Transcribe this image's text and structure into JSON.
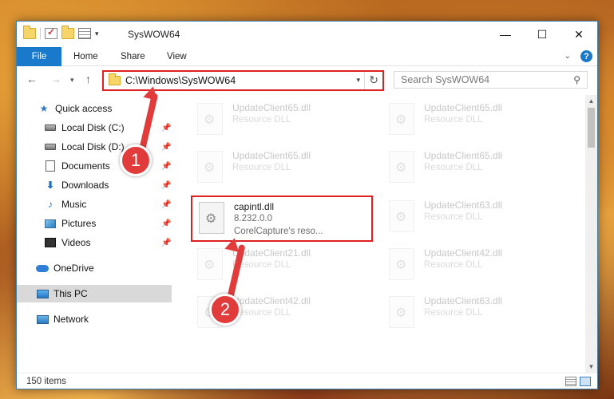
{
  "window": {
    "title": "SysWOW64",
    "controls": {
      "minimize": "—",
      "maximize": "☐",
      "close": "✕"
    }
  },
  "ribbon": {
    "tabs": [
      {
        "label": "File"
      },
      {
        "label": "Home"
      },
      {
        "label": "Share"
      },
      {
        "label": "View"
      }
    ]
  },
  "address": {
    "path": "C:\\Windows\\SysWOW64",
    "search_placeholder": "Search SysWOW64"
  },
  "sidebar": {
    "items": [
      {
        "label": "Quick access",
        "icon": "star-icon"
      },
      {
        "label": "Local Disk (C:)",
        "icon": "drive-icon"
      },
      {
        "label": "Local Disk (D:)",
        "icon": "drive-icon"
      },
      {
        "label": "Documents",
        "icon": "documents-icon"
      },
      {
        "label": "Downloads",
        "icon": "download-icon"
      },
      {
        "label": "Music",
        "icon": "music-icon"
      },
      {
        "label": "Pictures",
        "icon": "pictures-icon"
      },
      {
        "label": "Videos",
        "icon": "videos-icon"
      },
      {
        "label": "OneDrive",
        "icon": "cloud-icon"
      },
      {
        "label": "This PC",
        "icon": "computer-icon"
      },
      {
        "label": "Network",
        "icon": "network-icon"
      }
    ]
  },
  "files": [
    {
      "name": "UpdateClient65.dll",
      "type": "Resource DLL"
    },
    {
      "name": "UpdateClient65.dll",
      "type": "Resource DLL"
    },
    {
      "name": "UpdateClient65.dll",
      "type": "Resource DLL"
    },
    {
      "name": "UpdateClient65.dll",
      "type": "Resource DLL"
    },
    {
      "name": "capintl.dll",
      "version": "8.232.0.0",
      "description": "CorelCapture's reso..."
    },
    {
      "name": "UpdateClient63.dll",
      "type": "Resource DLL"
    },
    {
      "name": "UpdateClient21.dll",
      "type": "Resource DLL"
    },
    {
      "name": "UpdateClient42.dll",
      "type": "Resource DLL"
    },
    {
      "name": "UpdateClient42.dll",
      "type": "Resource DLL"
    },
    {
      "name": "UpdateClient63.dll",
      "type": "Resource DLL"
    }
  ],
  "status": {
    "item_count": "150 items"
  },
  "callouts": {
    "step1": "1",
    "step2": "2"
  },
  "colors": {
    "accent": "#1979ca",
    "highlight": "#e02020",
    "callout": "#e23b3b"
  }
}
